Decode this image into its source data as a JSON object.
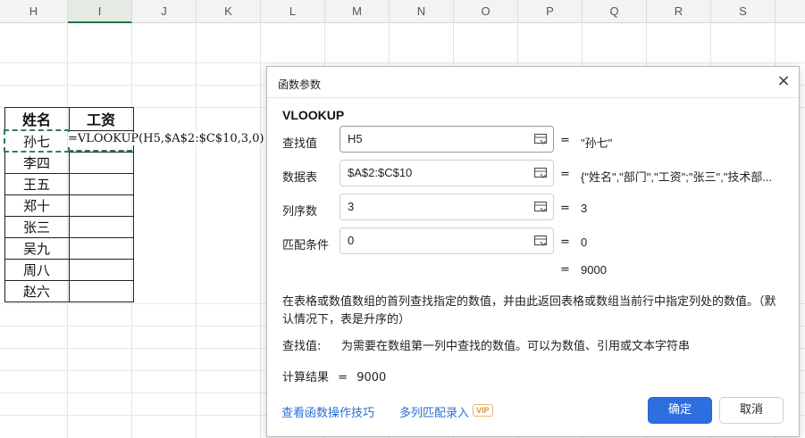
{
  "sheet": {
    "columns": [
      "H",
      "I",
      "J",
      "K",
      "L",
      "M",
      "N",
      "O",
      "P",
      "Q",
      "R",
      "S"
    ],
    "active_column": "I",
    "table_headers": [
      "姓名",
      "工资"
    ],
    "names": [
      "孙七",
      "李四",
      "王五",
      "郑十",
      "张三",
      "吴九",
      "周八",
      "赵六"
    ],
    "formula": "=VLOOKUP(H5,$A$2:$C$10,3,0)"
  },
  "dialog": {
    "title": "函数参数",
    "close": "×",
    "function_name": "VLOOKUP",
    "args": [
      {
        "label": "查找值",
        "value": "H5",
        "result": "\"孙七\""
      },
      {
        "label": "数据表",
        "value": "$A$2:$C$10",
        "result": "{\"姓名\",\"部门\",\"工资\";\"张三\",\"技术部..."
      },
      {
        "label": "列序数",
        "value": "3",
        "result": "3"
      },
      {
        "label": "匹配条件",
        "value": "0",
        "result": "0"
      }
    ],
    "eq": "=",
    "total_result": "9000",
    "description": "在表格或数值数组的首列查找指定的数值，并由此返回表格或数组当前行中指定列处的数值。（默认情况下，表是升序的）",
    "param_name": "查找值:",
    "param_desc": "为需要在数组第一列中查找的数值。可以为数值、引用或文本字符串",
    "calc_label": "计算结果",
    "calc_value": "9000",
    "link_tips": "查看函数操作技巧",
    "link_multi": "多列匹配录入",
    "vip": "VIP",
    "ok": "确定",
    "cancel": "取消"
  }
}
